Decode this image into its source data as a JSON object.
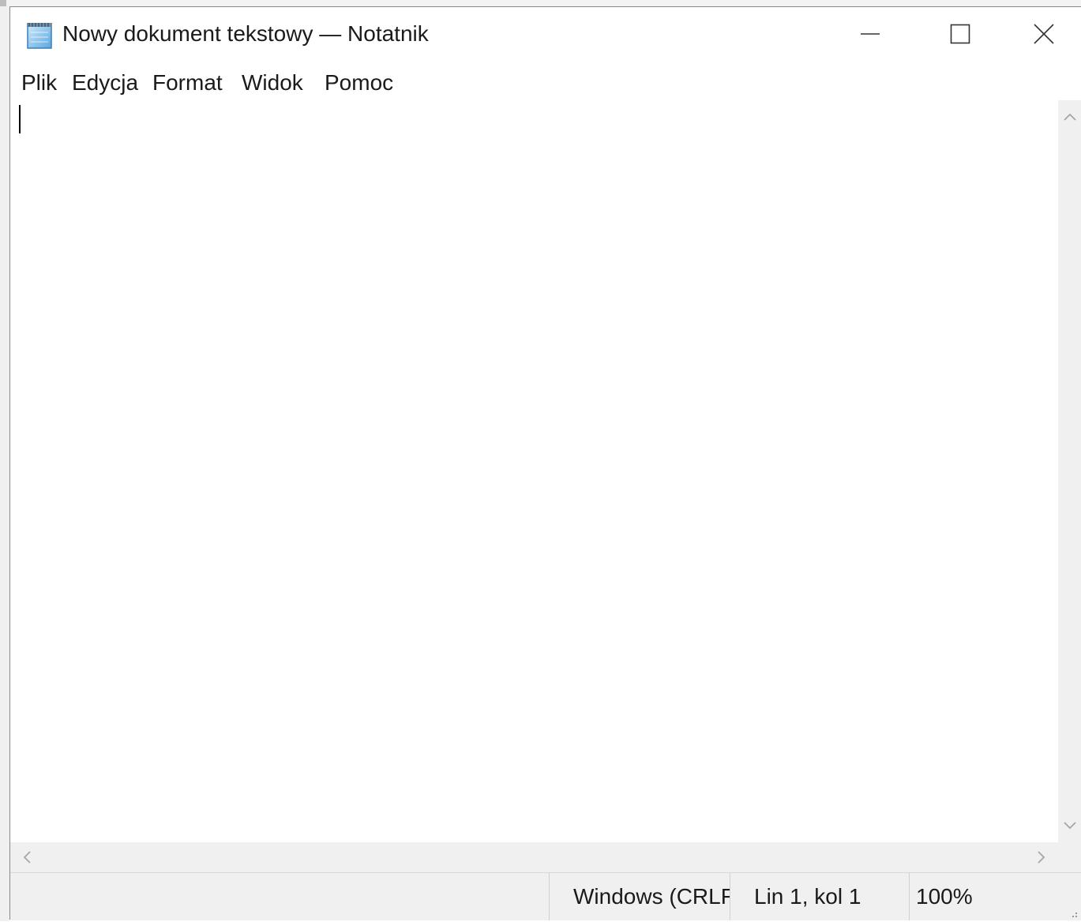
{
  "window": {
    "title": "Nowy dokument tekstowy — Notatnik",
    "app_icon": "notepad-icon",
    "caption_buttons": [
      "minimize-icon",
      "maximize-icon",
      "close-icon"
    ]
  },
  "menubar": {
    "items": [
      {
        "label": "Plik"
      },
      {
        "label": "Edycja"
      },
      {
        "label": "Format"
      },
      {
        "label": "Widok"
      },
      {
        "label": "Pomoc"
      }
    ]
  },
  "editor": {
    "content": ""
  },
  "scrollbars": {
    "vertical_icons": [
      "chevron-up-icon",
      "chevron-down-icon"
    ],
    "horizontal_icons": [
      "chevron-left-icon",
      "chevron-right-icon"
    ]
  },
  "statusbar": {
    "line_ending": "Windows (CRLF)",
    "position": "Lin 1, kol 1",
    "zoom": "100%"
  },
  "colors": {
    "window_bg": "#ffffff",
    "chrome_bg": "#f0f0f0",
    "text": "#1a1a1a",
    "icon": "#333333"
  }
}
